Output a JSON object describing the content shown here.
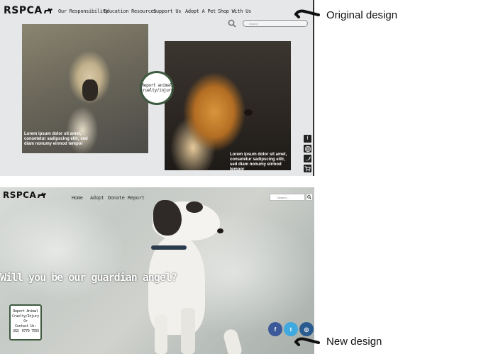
{
  "original": {
    "logo": "RSPCA",
    "nav": [
      "Our Responsibility",
      "Education Resources",
      "Support Us",
      "Adopt A Pet",
      "Shop With Us"
    ],
    "search_placeholder": "Search",
    "report_button": "Report animal cruelty/injury",
    "caption1": "Lorem ipsum dolor sit amet, consetetur sadipscing elitr, sed diam nonumy eirmod tempor",
    "caption2": "Lorem ipsum dolor sit amet, consetetur sadipscing elitr, sed diam nonumy eirmod tempor",
    "social_icons": [
      "facebook-icon",
      "instagram-icon",
      "twitter-icon",
      "cart-icon"
    ]
  },
  "new_design": {
    "logo": "RSPCA",
    "nav": [
      "Home",
      "Adopt",
      "Donate",
      "Report"
    ],
    "search_placeholder": "Search...",
    "hero_text": "Will you be our guardian angel?",
    "report_box": {
      "line1": "Report Animal",
      "line2": "Cruelty/Injury",
      "line3": "Or",
      "line4": "Contact Us:",
      "line5": "(02) 9770 7555"
    },
    "social": [
      {
        "icon": "facebook-icon",
        "glyph": "f",
        "color": "#3b5998"
      },
      {
        "icon": "twitter-icon",
        "glyph": "t",
        "color": "#3fa9e0"
      },
      {
        "icon": "instagram-icon",
        "glyph": "◎",
        "color": "#2a5b8f"
      }
    ]
  },
  "annotations": {
    "original_label": "Original design",
    "new_label": "New design"
  }
}
